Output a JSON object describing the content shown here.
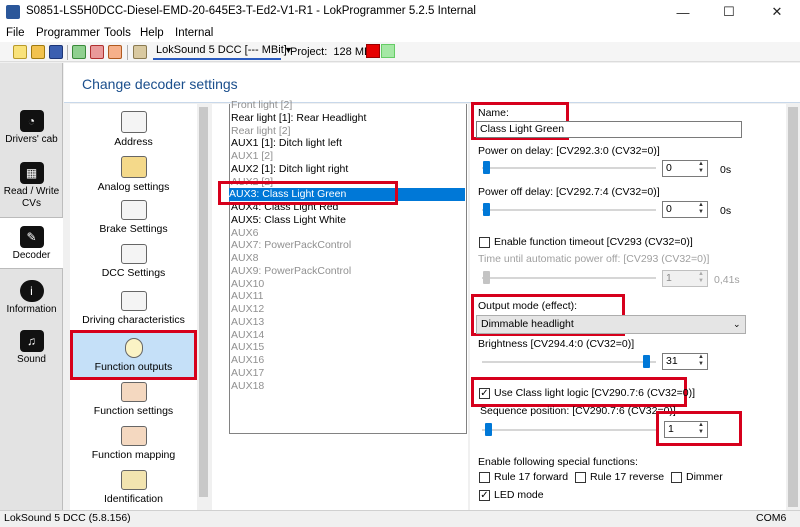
{
  "window": {
    "title": "S0851-LS5H0DCC-Diesel-EMD-20-645E3-T-Ed2-V1-R1 - LokProgrammer 5.2.5 Internal",
    "minimize": "—",
    "maximize": "☐",
    "close": "✕"
  },
  "menu": [
    "File",
    "Programmer",
    "Tools",
    "Help",
    "Internal"
  ],
  "toolbar": {
    "decoder": "LokSound 5 DCC [--- MBit]",
    "project_label": "Project:",
    "project_size": "128 MBit",
    "colors": {
      "red": "#e60000",
      "green": "#a5e8a5"
    }
  },
  "nav": [
    {
      "label": "Drivers' cab",
      "icon": "speedometer-icon"
    },
    {
      "label": "Read / Write CVs",
      "icon": "cv-grid-icon"
    },
    {
      "label": "Decoder",
      "icon": "wrench-icon"
    },
    {
      "label": "Information",
      "icon": "info-icon"
    },
    {
      "label": "Sound",
      "icon": "music-note-icon"
    }
  ],
  "header": {
    "title": "Change decoder settings"
  },
  "settings": [
    {
      "label": "Address",
      "icon": "envelope-icon"
    },
    {
      "label": "Analog settings",
      "icon": "horn-icon"
    },
    {
      "label": "Brake Settings",
      "icon": "brake-icon"
    },
    {
      "label": "DCC Settings",
      "icon": "dcc-icon"
    },
    {
      "label": "Driving characteristics",
      "icon": "sliders-icon"
    },
    {
      "label": "Function outputs",
      "icon": "bulb-icon"
    },
    {
      "label": "Function settings",
      "icon": "function-settings-icon"
    },
    {
      "label": "Function mapping",
      "icon": "function-mapping-icon"
    },
    {
      "label": "Identification",
      "icon": "id-card-icon"
    }
  ],
  "outputs": [
    {
      "label": "Front light [2]",
      "state": "inactive"
    },
    {
      "label": "Rear light [1]: Rear Headlight",
      "state": "active"
    },
    {
      "label": "Rear light [2]",
      "state": "inactive"
    },
    {
      "label": "AUX1 [1]: Ditch light left",
      "state": "active"
    },
    {
      "label": "AUX1 [2]",
      "state": "inactive"
    },
    {
      "label": "AUX2 [1]: Ditch light right",
      "state": "active"
    },
    {
      "label": "AUX2 [2]",
      "state": "inactive"
    },
    {
      "label": "AUX3: Class Light Green",
      "state": "selected"
    },
    {
      "label": "AUX4: Class Light Red",
      "state": "active"
    },
    {
      "label": "AUX5: Class Light White",
      "state": "active"
    },
    {
      "label": "AUX6",
      "state": "inactive"
    },
    {
      "label": "AUX7: PowerPackControl",
      "state": "inactive"
    },
    {
      "label": "AUX8",
      "state": "inactive"
    },
    {
      "label": "AUX9: PowerPackControl",
      "state": "inactive"
    },
    {
      "label": "AUX10",
      "state": "inactive"
    },
    {
      "label": "AUX11",
      "state": "inactive"
    },
    {
      "label": "AUX12",
      "state": "inactive"
    },
    {
      "label": "AUX13",
      "state": "inactive"
    },
    {
      "label": "AUX14",
      "state": "inactive"
    },
    {
      "label": "AUX15",
      "state": "inactive"
    },
    {
      "label": "AUX16",
      "state": "inactive"
    },
    {
      "label": "AUX17",
      "state": "inactive"
    },
    {
      "label": "AUX18",
      "state": "inactive"
    }
  ],
  "details": {
    "name_label": "Name:",
    "name_value": "Class Light Green",
    "power_on_label": "Power on delay: [CV292.3:0 (CV32=0)]",
    "power_on_value": "0",
    "power_on_unit": "0s",
    "power_off_label": "Power off delay: [CV292.7:4 (CV32=0)]",
    "power_off_value": "0",
    "power_off_unit": "0s",
    "timeout_label": "Enable function timeout [CV293 (CV32=0)]",
    "timeout_checked": false,
    "auto_off_label": "Time until automatic power off: [CV293 (CV32=0)]",
    "auto_off_value": "1",
    "auto_off_unit": "0,41s",
    "output_mode_label": "Output mode (effect):",
    "output_mode_value": "Dimmable headlight",
    "brightness_label": "Brightness [CV294.4:0 (CV32=0)]",
    "brightness_value": "31",
    "brightness_fraction": 1.0,
    "class_light_label": "Use Class light logic [CV290.7:6 (CV32=0)]",
    "class_light_checked": true,
    "sequence_label": "Sequence position: [CV290.7:6 (CV32=0)]",
    "sequence_value": "1",
    "special_label": "Enable following special functions:",
    "special": [
      {
        "label": "Rule 17 forward",
        "checked": false
      },
      {
        "label": "Rule 17 reverse",
        "checked": false
      },
      {
        "label": "Dimmer",
        "checked": false
      },
      {
        "label": "LED mode",
        "checked": true
      }
    ]
  },
  "status": {
    "left": "LokSound 5 DCC (5.8.156)",
    "right": "COM6"
  }
}
